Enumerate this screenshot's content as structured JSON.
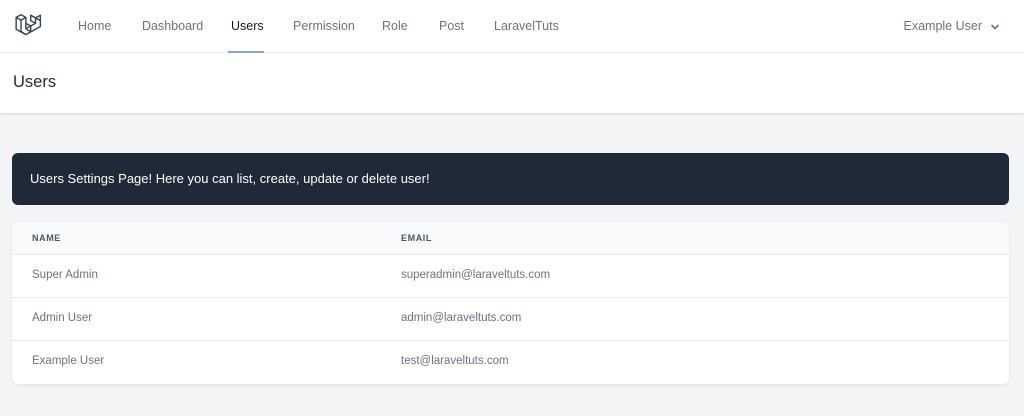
{
  "nav": {
    "links": [
      "Home",
      "Dashboard",
      "Users",
      "Permission",
      "Role",
      "Post",
      "LaravelTuts"
    ],
    "active_index": 2,
    "user_name": "Example User"
  },
  "header": {
    "title": "Users"
  },
  "banner": {
    "text": "Users Settings Page! Here you can list, create, update or delete user!"
  },
  "table": {
    "headers": [
      "NAME",
      "EMAIL"
    ],
    "rows": [
      [
        "Super Admin",
        "superadmin@laraveltuts.com"
      ],
      [
        "Admin User",
        "admin@laraveltuts.com"
      ],
      [
        "Example User",
        "test@laraveltuts.com"
      ]
    ]
  },
  "colors": {
    "banner_bg": "#1f2937",
    "active_underline": "#8ea6c8",
    "page_bg": "#f3f4f6"
  }
}
